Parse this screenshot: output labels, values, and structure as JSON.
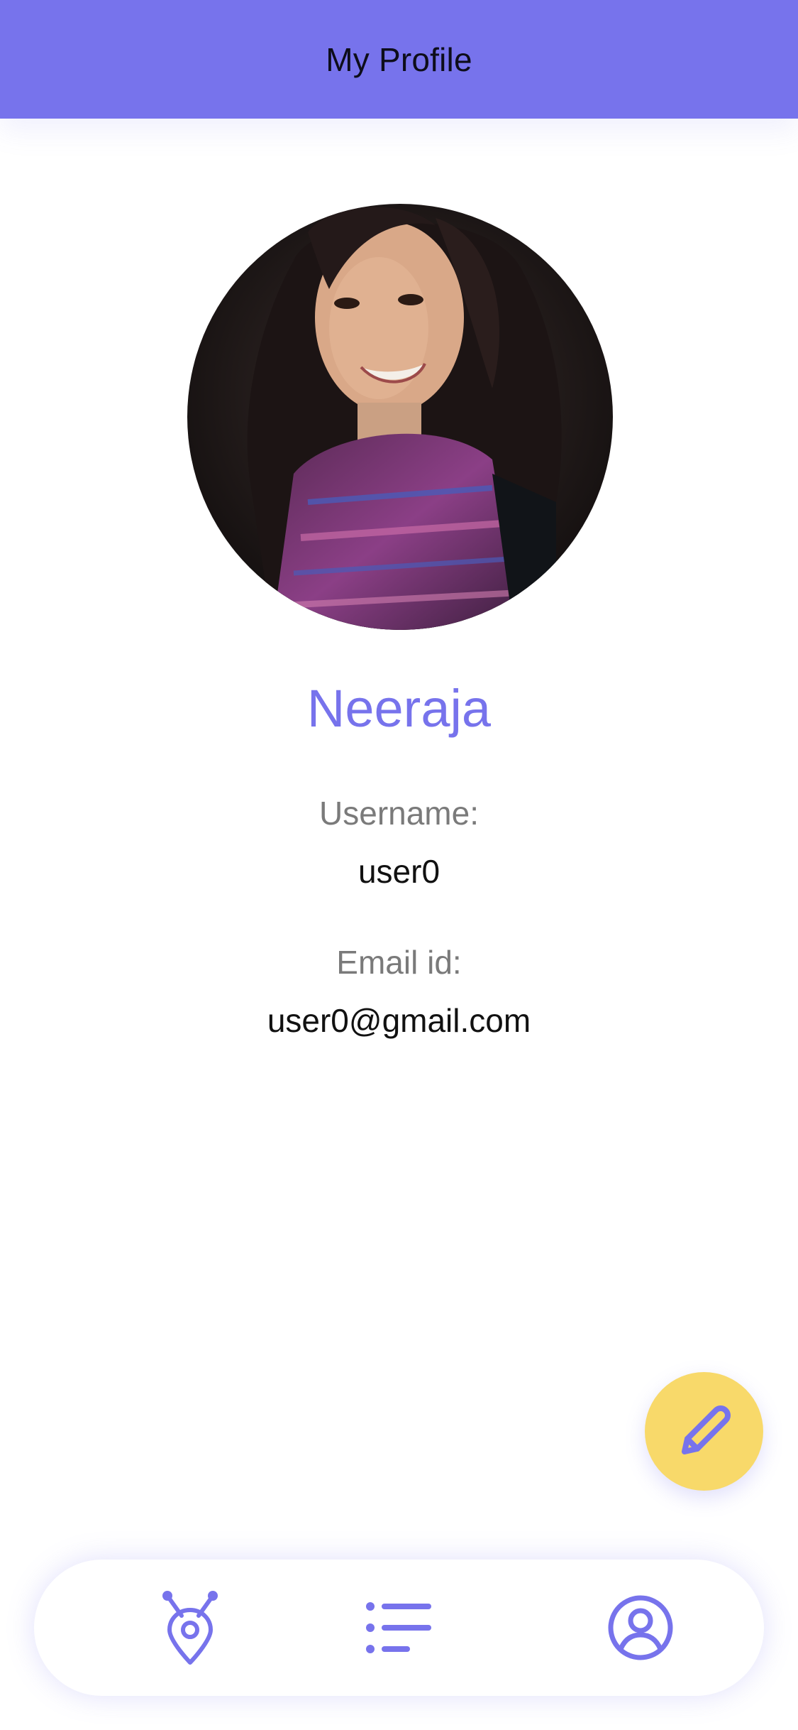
{
  "header": {
    "title": "My Profile"
  },
  "profile": {
    "name": "Neeraja",
    "username_label": "Username:",
    "username_value": "user0",
    "email_label": "Email id:",
    "email_value": "user0@gmail.com"
  },
  "fab": {
    "icon": "pencil-icon"
  },
  "bottom_nav": {
    "items": [
      {
        "icon": "location-pin-icon"
      },
      {
        "icon": "list-icon"
      },
      {
        "icon": "user-circle-icon"
      }
    ]
  },
  "colors": {
    "accent": "#7773ec",
    "fab": "#f8d96a",
    "label_gray": "#7a7a7a"
  }
}
